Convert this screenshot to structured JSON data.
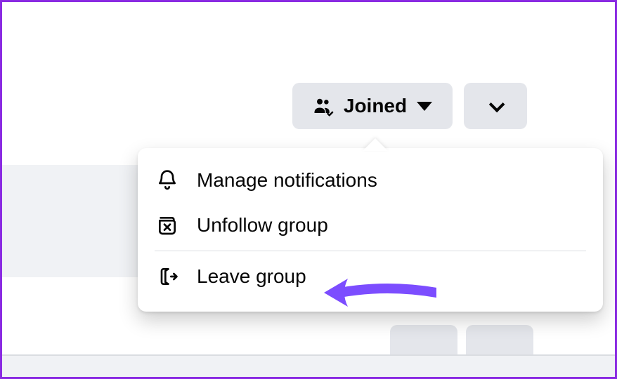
{
  "colors": {
    "accent_border": "#8a2be2",
    "button_bg": "#e4e6eb",
    "text": "#050505",
    "annotation_arrow": "#7c4dff"
  },
  "header": {
    "joined_button_label": "Joined",
    "chevron_button_label": ""
  },
  "menu": {
    "items": [
      {
        "icon": "bell-icon",
        "label": "Manage notifications"
      },
      {
        "icon": "unfollow-icon",
        "label": "Unfollow group"
      }
    ],
    "leave": {
      "icon": "leave-icon",
      "label": "Leave group"
    }
  }
}
